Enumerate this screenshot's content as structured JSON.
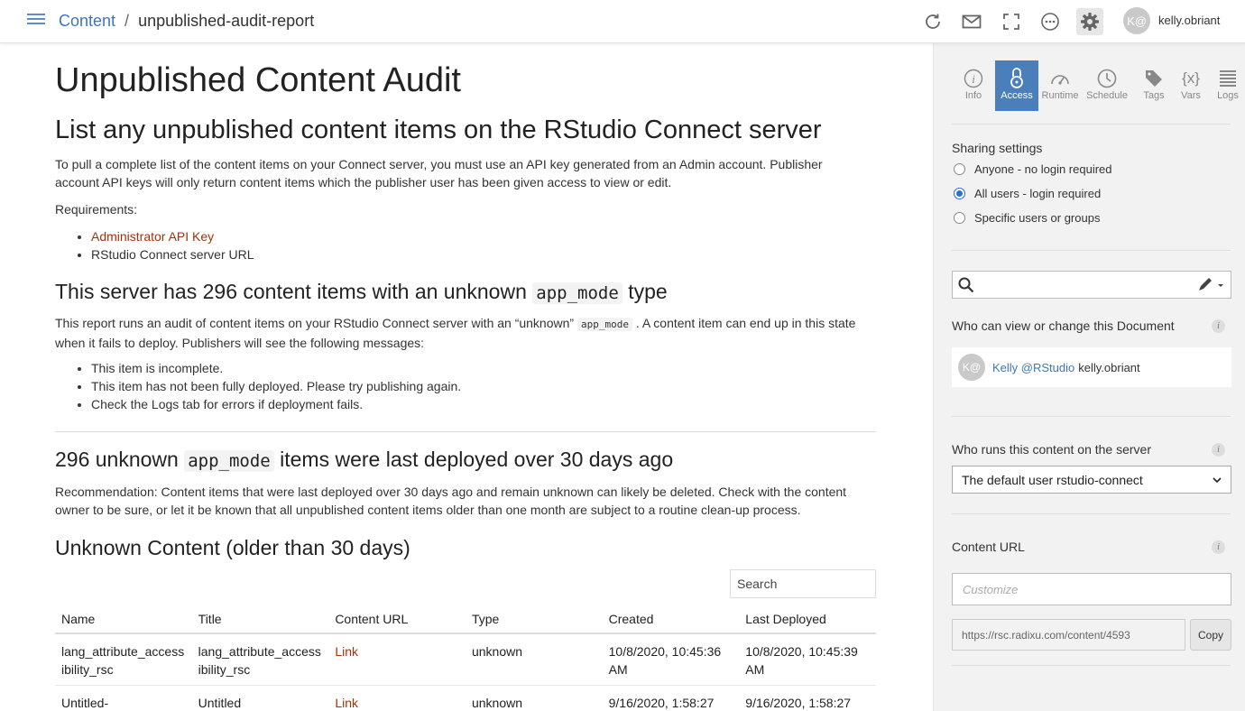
{
  "header": {
    "breadcrumb_root": "Content",
    "breadcrumb_separator": "/",
    "breadcrumb_current": "unpublished-audit-report",
    "username": "kelly.obriant",
    "avatar_initials": "K@",
    "icons": [
      "refresh-icon",
      "mail-icon",
      "fullscreen-icon",
      "more-icon",
      "gear-icon"
    ]
  },
  "document": {
    "title": "Unpublished Content Audit",
    "section1_heading": "List any unpublished content items on the RStudio Connect server",
    "section1_para": "To pull a complete list of the content items on your Connect server, you must use an API key generated from an Admin account. Publisher account API keys will only return content items which the publisher user has been given access to view or edit.",
    "requirements_label": "Requirements:",
    "requirements": [
      {
        "text": "Administrator API Key",
        "is_link": true
      },
      {
        "text": "RStudio Connect server URL",
        "is_link": false
      }
    ],
    "section2_heading_pre": "This server has 296 content items with an unknown",
    "section2_heading_code": "app_mode",
    "section2_heading_post": "type",
    "section2_para_pre": "This report runs an audit of content items on your RStudio Connect server with an “unknown”",
    "section2_para_code": "app_mode",
    "section2_para_post": ". A content item can end up in this state when it fails to deploy. Publishers will see the following messages:",
    "messages": [
      "This item is incomplete.",
      "This item has not been fully deployed. Please try publishing again.",
      "Check the Logs tab for errors if deployment fails."
    ],
    "section3_heading_pre": "296 unknown",
    "section3_heading_code": "app_mode",
    "section3_heading_post": "items were last deployed over 30 days ago",
    "section3_para": "Recommendation: Content items that were last deployed over 30 days ago and remain unknown can likely be deleted. Check with the content owner to be sure, or let it be known that all unpublished content items older than one month are subject to a routine clean-up process.",
    "table_heading": "Unknown Content (older than 30 days)",
    "search_placeholder": "Search",
    "table": {
      "columns": [
        "Name",
        "Title",
        "Content URL",
        "Type",
        "Created",
        "Last Deployed"
      ],
      "rows": [
        [
          "lang_attribute_accessibility_rsc",
          "lang_attribute_accessibility_rsc",
          "Link",
          "unknown",
          "10/8/2020, 10:45:36 AM",
          "10/8/2020, 10:45:39 AM"
        ],
        [
          "Untitled-",
          "Untitled",
          "Link",
          "unknown",
          "9/16/2020, 1:58:27",
          "9/16/2020, 1:58:27"
        ]
      ]
    }
  },
  "sidebar": {
    "tabs": [
      {
        "label": "Info",
        "icon": "info-icon"
      },
      {
        "label": "Access",
        "icon": "lock-icon",
        "active": true
      },
      {
        "label": "Runtime",
        "icon": "speedometer-icon"
      },
      {
        "label": "Schedule",
        "icon": "clock-icon"
      },
      {
        "label": "Tags",
        "icon": "tag-icon"
      },
      {
        "label": "Vars",
        "icon": "variable-icon",
        "glyph": "{x}"
      },
      {
        "label": "Logs",
        "icon": "logs-icon"
      }
    ],
    "sharing_label": "Sharing settings",
    "sharing_options": [
      {
        "label": "Anyone - no login required",
        "checked": false
      },
      {
        "label": "All users - login required",
        "checked": true
      },
      {
        "label": "Specific users or groups",
        "checked": false
      }
    ],
    "viewers_label": "Who can view or change this Document",
    "viewer": {
      "initials": "K@",
      "name": "Kelly @RStudio",
      "username": "kelly.obriant"
    },
    "runas_label": "Who runs this content on the server",
    "runas_value": "The default user rstudio-connect",
    "content_url_label": "Content URL",
    "customize_placeholder": "Customize",
    "content_url": "https://rsc.radixu.com/content/4593",
    "copy_label": "Copy",
    "active_tab_color": "#4a7fbc"
  }
}
